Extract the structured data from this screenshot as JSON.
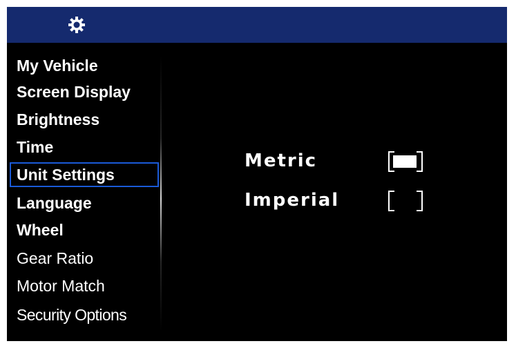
{
  "header": {
    "icon": "gear-icon",
    "background_color": "#152a6e"
  },
  "sidebar": {
    "selected_color": "#1a5ad8",
    "items": [
      {
        "label": "My Vehicle"
      },
      {
        "label": "Screen Display"
      },
      {
        "label": "Brightness"
      },
      {
        "label": "Time"
      },
      {
        "label": "Unit Settings",
        "selected": true
      },
      {
        "label": "Language"
      },
      {
        "label": "Wheel"
      },
      {
        "label": "Gear Ratio"
      },
      {
        "label": "Motor Match"
      },
      {
        "label": "Security Options"
      }
    ]
  },
  "unit_settings": {
    "options": [
      {
        "label": "Metric",
        "checked": true
      },
      {
        "label": "Imperial",
        "checked": false
      }
    ]
  }
}
